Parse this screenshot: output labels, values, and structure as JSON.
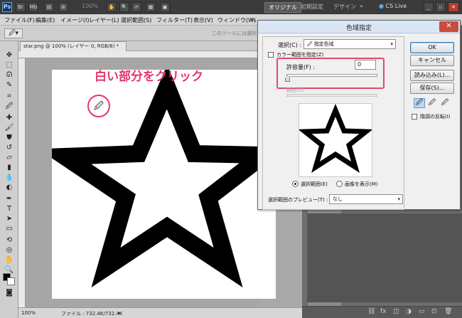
{
  "appbar": {
    "logo": "Ps",
    "zoom": "100%",
    "workspaces": [
      "オリジナル",
      "初期設定",
      "デザイン"
    ],
    "more": "»",
    "cslive": "CS Live"
  },
  "menu": [
    "ファイル(F)",
    "編集(E)",
    "イメージ(I)",
    "レイヤー(L)",
    "選択範囲(S)",
    "フィルター(T)",
    "表示(V)",
    "ウィンドウ(W)",
    "ヘ"
  ],
  "options": {
    "hint": "このツールには選択"
  },
  "document": {
    "tab_title": "star.png @ 100% (レイヤー 0, RGB/8) *",
    "zoom": "100%",
    "file_info": "ファイル : 732.4K/732.4K"
  },
  "annotation": {
    "text": "白い部分をクリック",
    "color": "#e4376a"
  },
  "dialog": {
    "title": "色域指定",
    "select_label": "選択(C) :",
    "select_value": "指定色域",
    "localized_label": "カラー範囲を指定(Z)",
    "tolerance_label": "許容量(F) :",
    "tolerance_value": "0",
    "range_label": "範囲(R)",
    "radio_selection": "選択範囲(E)",
    "radio_image": "画像を表示(M)",
    "preview_label": "選択範囲のプレビュー(T) :",
    "preview_value": "なし",
    "buttons": {
      "ok": "OK",
      "cancel": "キャンセル",
      "load": "読み込み(L)...",
      "save": "保存(S)..."
    },
    "invert_label": "階調の反転(I)"
  },
  "colors": {
    "highlight": "#e4476b",
    "titlebar": "#d9e6f4",
    "close": "#c94c3d"
  }
}
